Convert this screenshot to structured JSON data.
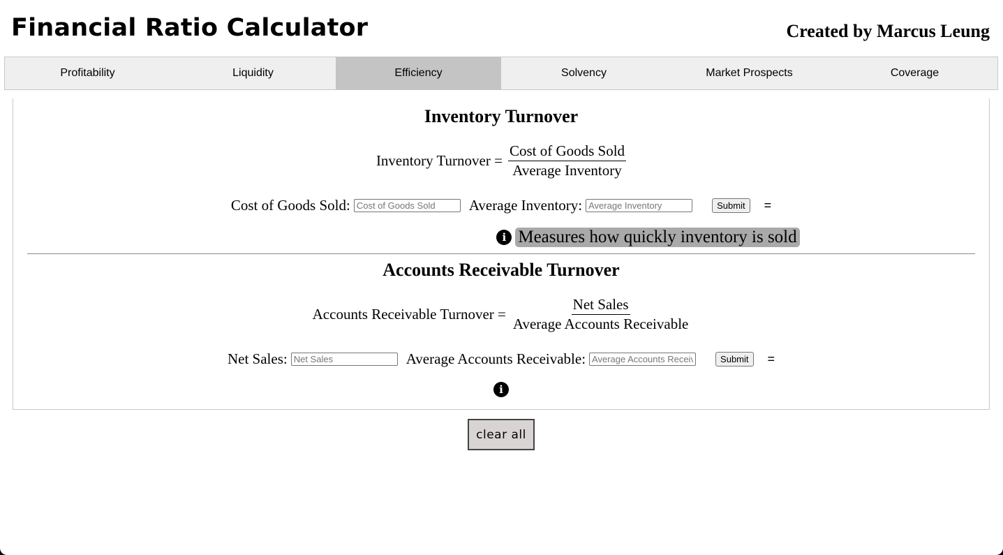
{
  "header": {
    "title": "Financial Ratio Calculator",
    "author": "Created by Marcus Leung"
  },
  "tabs": [
    {
      "label": "Profitability",
      "active": false
    },
    {
      "label": "Liquidity",
      "active": false
    },
    {
      "label": "Efficiency",
      "active": true
    },
    {
      "label": "Solvency",
      "active": false
    },
    {
      "label": "Market Prospects",
      "active": false
    },
    {
      "label": "Coverage",
      "active": false
    }
  ],
  "sections": [
    {
      "title": "Inventory Turnover",
      "formula_lhs": "Inventory Turnover =",
      "numerator": "Cost of Goods Sold",
      "denominator": "Average Inventory",
      "input1_label": "Cost of Goods Sold:",
      "input1_placeholder": "Cost of Goods Sold",
      "input1_value": "",
      "input2_label": "Average Inventory:",
      "input2_placeholder": "Average Inventory",
      "input2_value": "",
      "submit_label": "Submit",
      "equals": "=",
      "result": "",
      "info_icon": "info-icon",
      "tooltip": "Measures how quickly inventory is sold"
    },
    {
      "title": "Accounts Receivable Turnover",
      "formula_lhs": "Accounts Receivable Turnover =",
      "numerator": "Net Sales",
      "denominator": "Average Accounts Receivable",
      "input1_label": "Net Sales:",
      "input1_placeholder": "Net Sales",
      "input1_value": "",
      "input2_label": "Average Accounts Receivable:",
      "input2_placeholder": "Average Accounts Receivable",
      "input2_value": "",
      "submit_label": "Submit",
      "equals": "=",
      "result": "",
      "info_icon": "info-icon"
    }
  ],
  "clear_all_label": "clear all",
  "colors": {
    "tab_bar": "#efefef",
    "tab_active": "#c4c4c4",
    "tooltip_bg": "#a9a9a9",
    "clear_button_bg": "#d9d4d4"
  }
}
